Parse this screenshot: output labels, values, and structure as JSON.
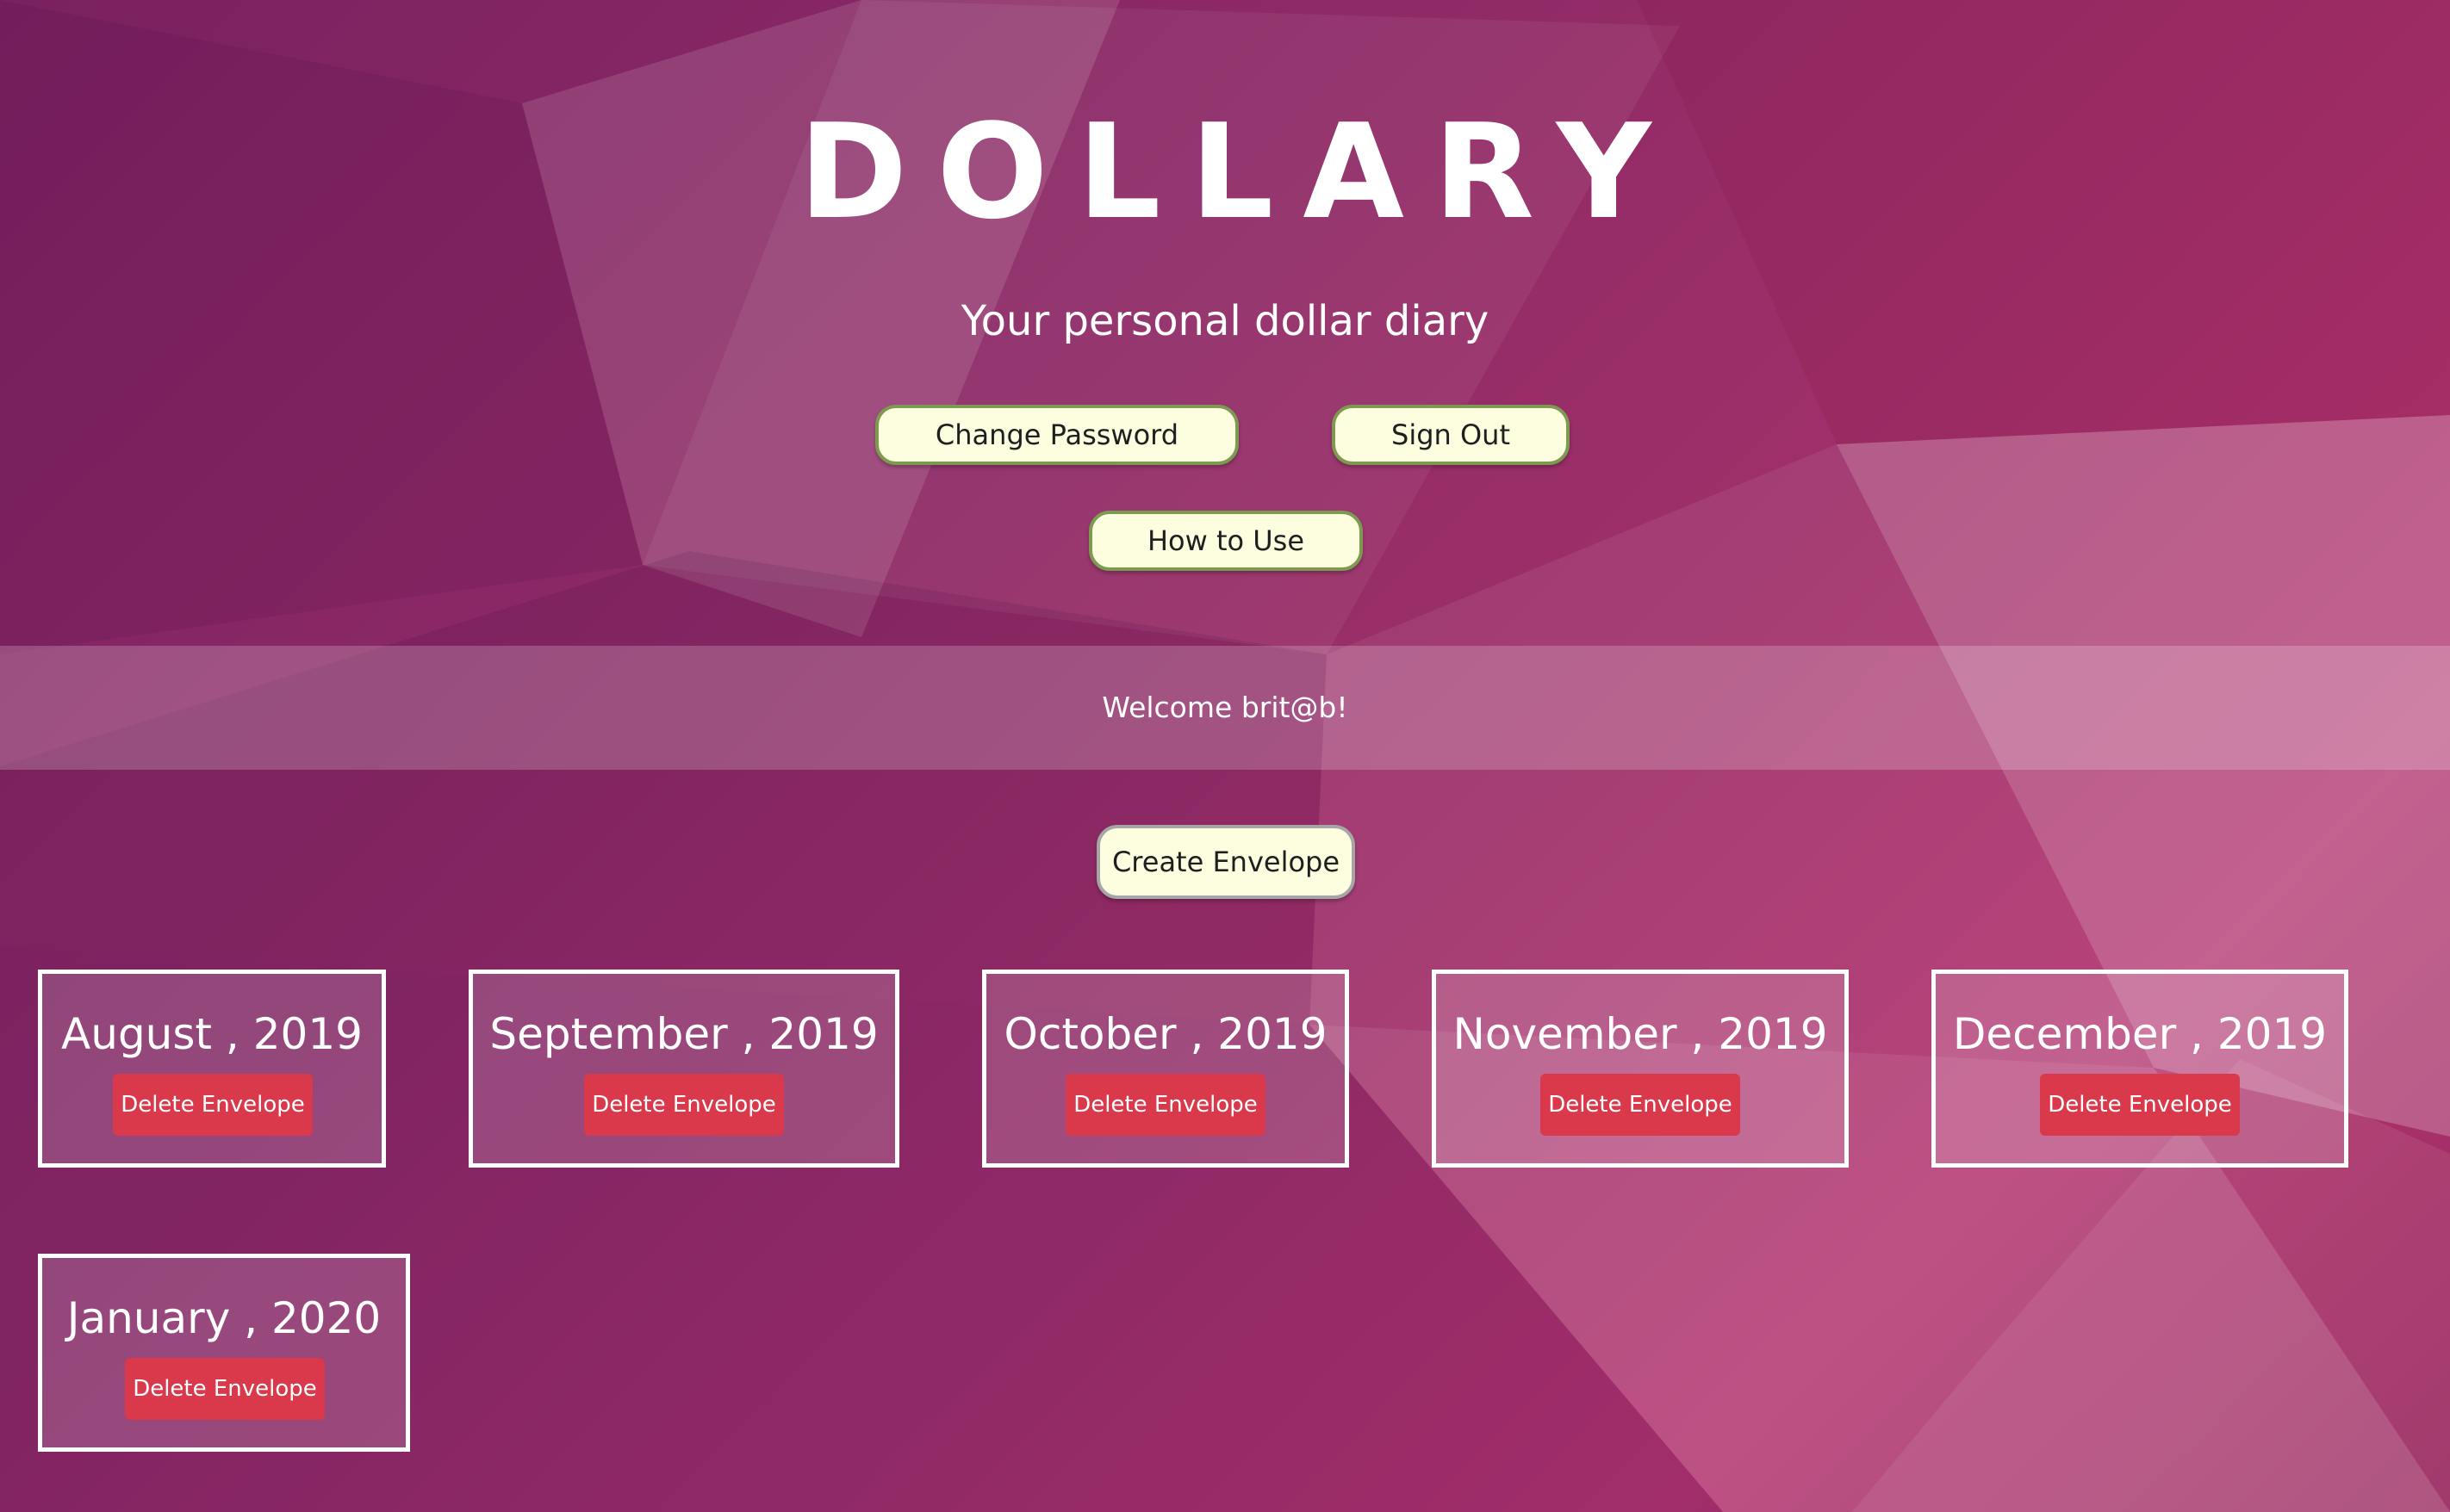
{
  "brand": {
    "title": "DOLLARY",
    "tagline": "Your personal dollar diary"
  },
  "nav": {
    "change_password": "Change Password",
    "sign_out": "Sign Out",
    "how_to_use": "How to Use"
  },
  "welcome": {
    "message": "Welcome brit@b!"
  },
  "actions": {
    "create_envelope": "Create Envelope"
  },
  "envelopes": [
    {
      "label": "August , 2019",
      "delete_label": "Delete Envelope"
    },
    {
      "label": "September , 2019",
      "delete_label": "Delete Envelope"
    },
    {
      "label": "October , 2019",
      "delete_label": "Delete Envelope"
    },
    {
      "label": "November , 2019",
      "delete_label": "Delete Envelope"
    },
    {
      "label": "December , 2019",
      "delete_label": "Delete Envelope"
    },
    {
      "label": "January , 2020",
      "delete_label": "Delete Envelope"
    }
  ],
  "colors": {
    "background_primary": "#8e2a66",
    "background_accent": "#b23570",
    "button_fill": "#fdfde0",
    "button_border": "#7e9a50",
    "delete_button": "#d9394a",
    "text_light": "#ffffff"
  }
}
